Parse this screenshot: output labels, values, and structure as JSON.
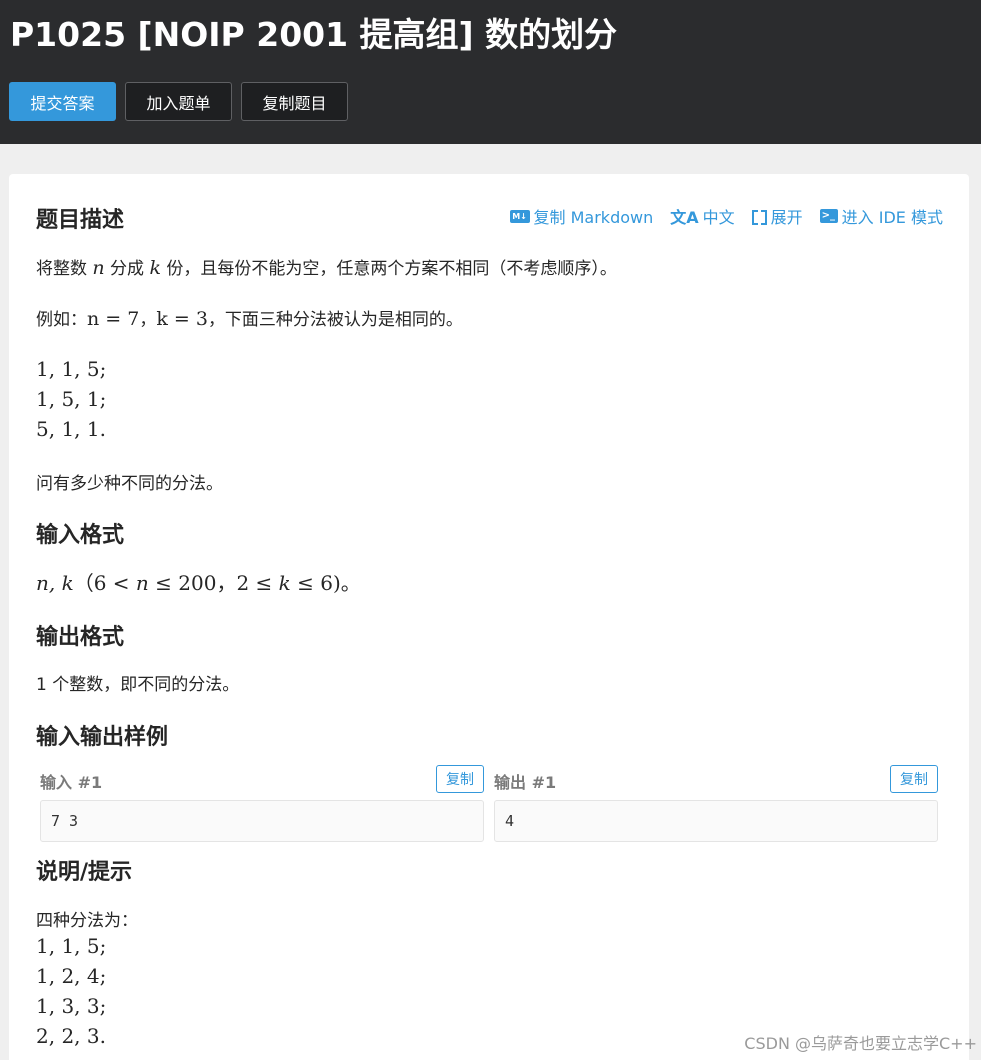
{
  "header": {
    "title": "P1025 [NOIP 2001 提高组] 数的划分",
    "buttons": {
      "submit": "提交答案",
      "add_to_list": "加入题单",
      "copy_problem": "复制题目"
    }
  },
  "toolbar": {
    "copy_markdown": "复制 Markdown",
    "language": "中文",
    "expand": "展开",
    "ide_mode": "进入 IDE 模式"
  },
  "description": {
    "heading": "题目描述",
    "line1": {
      "before_n": "将整数 ",
      "n": "n",
      "mid": " 分成 ",
      "k": "k",
      "after": " 份，且每份不能为空，任意两个方案不相同（不考虑顺序）。"
    },
    "line2": {
      "prefix": "例如：",
      "n_eq": "n = 7",
      "sep": "，",
      "k_eq": "k = 3",
      "suffix": "，下面三种分法被认为是相同的。"
    },
    "examples": [
      "1, 1, 5;",
      "1, 5, 1;",
      "5, 1, 1."
    ],
    "question": "问有多少种不同的分法。"
  },
  "input_format": {
    "heading": "输入格式",
    "vars": "n, k",
    "constraint_open": "（6 < ",
    "n": "n",
    "c_mid1": " ≤ 200，2 ≤ ",
    "k": "k",
    "c_end": " ≤ 6)。"
  },
  "output_format": {
    "heading": "输出格式",
    "text": "1 个整数，即不同的分法。"
  },
  "samples": {
    "heading": "输入输出样例",
    "input_label": "输入 #1",
    "output_label": "输出 #1",
    "copy_label": "复制",
    "input_value": "7 3",
    "output_value": "4"
  },
  "hint": {
    "heading": "说明/提示",
    "intro": "四种分法为：",
    "lines": [
      "1, 1, 5;",
      "1, 2, 4;",
      "1, 3, 3;",
      "2, 2, 3."
    ]
  },
  "watermark": "CSDN @乌萨奇也要立志学C++",
  "colors": {
    "accent": "#3498db",
    "header_bg": "#2b2c2e",
    "page_bg": "#efefef"
  }
}
